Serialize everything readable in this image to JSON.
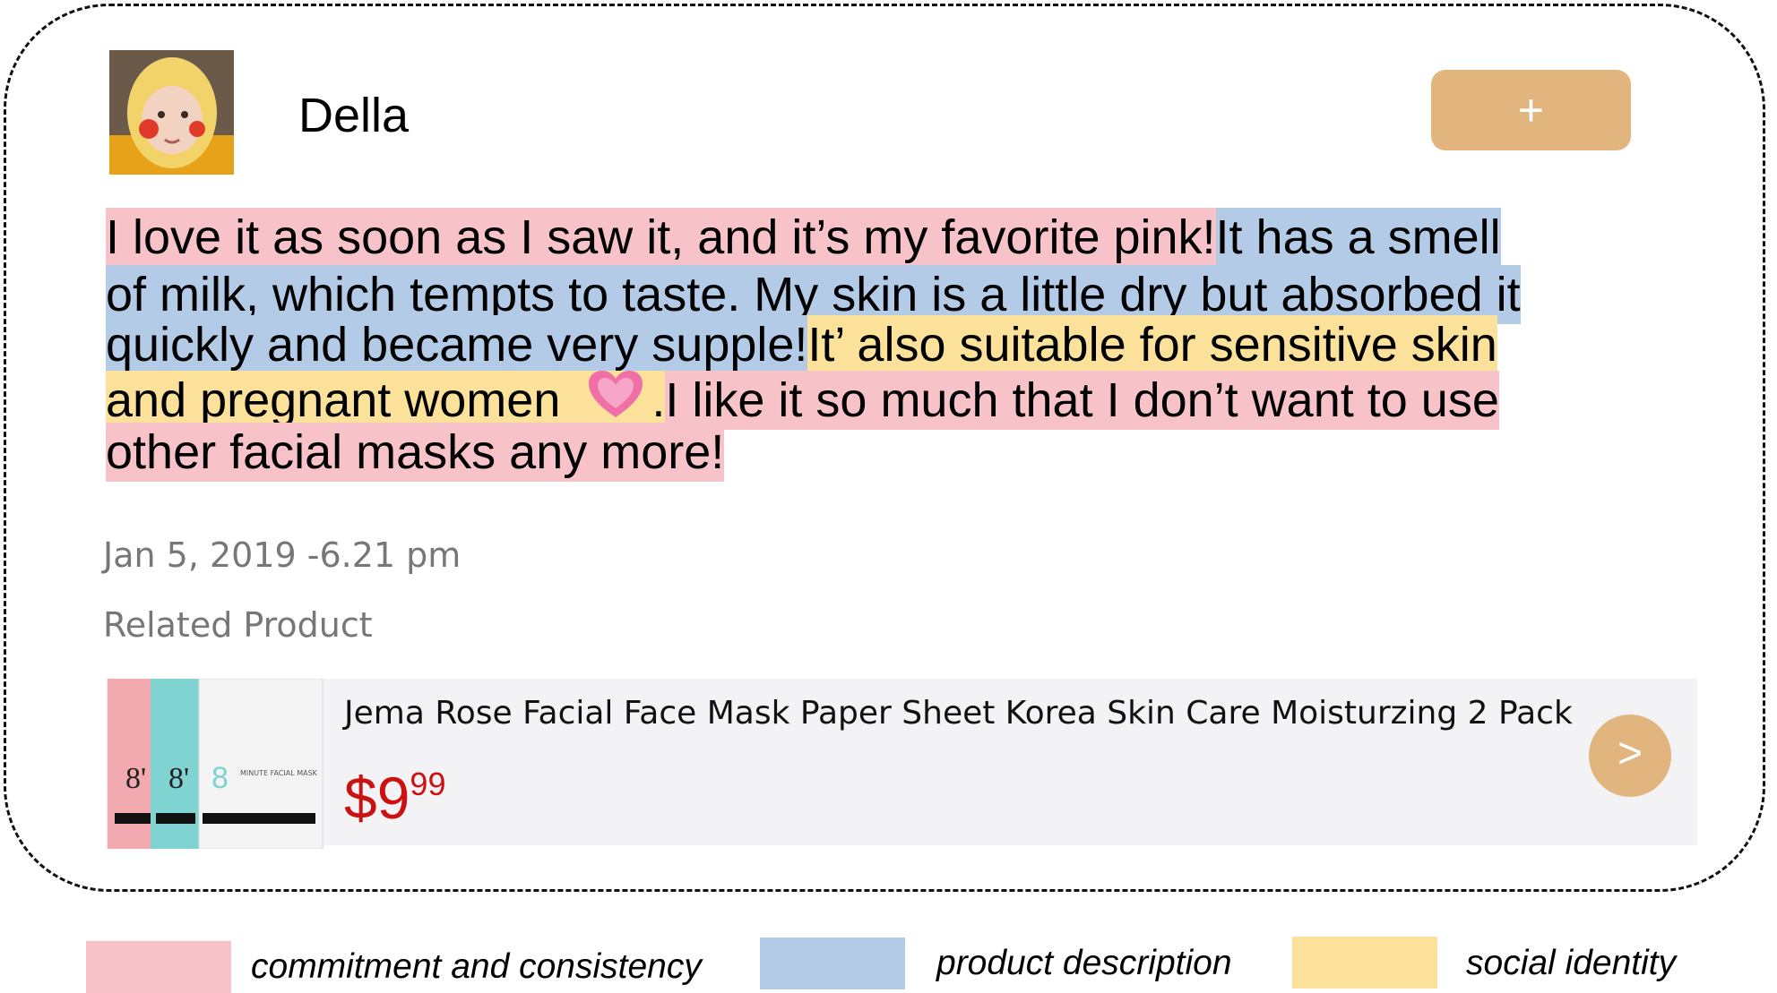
{
  "post": {
    "username": "Della",
    "follow_label": "+",
    "review_lines": [
      [
        {
          "text": "I love it as soon as I saw it, and it’s my favorite pink! ",
          "type": "commitment"
        },
        {
          "text": "It has a smell",
          "type": "product"
        }
      ],
      [
        {
          "text": "of milk, which tempts to taste. My skin is a little dry but absorbed it",
          "type": "product"
        }
      ],
      [
        {
          "text": "quickly and became very supple! ",
          "type": "product"
        },
        {
          "text": "It’ also suitable for sensitive skin",
          "type": "social"
        }
      ],
      [
        {
          "text": "and pregnant women",
          "type": "social"
        },
        {
          "text": ". ",
          "type": "social"
        },
        {
          "text": "I like it so much that I don’t want to use",
          "type": "commitment"
        }
      ],
      [
        {
          "text": "other facial masks any more!",
          "type": "commitment"
        }
      ]
    ],
    "date": "Jan 5, 2019 -6.21 pm",
    "related_label": "Related Product"
  },
  "product": {
    "title": "Jema Rose Facial Face Mask Paper Sheet Korea Skin Care Moisturzing 2 Pack",
    "price_dollars": "$9",
    "price_cents": "99",
    "go_label": ">",
    "image_text": {
      "num1": "8'",
      "num2": "8'",
      "num3": "8",
      "mask_label": "MINUTE FACIAL MASK"
    }
  },
  "legend": [
    {
      "label": "commitment and consistency",
      "color": "#f7c3c8"
    },
    {
      "label": "product description",
      "color": "#b4cbe8"
    },
    {
      "label": "social identity",
      "color": "#fce19a"
    }
  ],
  "colors": {
    "accent": "#e2b57e",
    "price": "#cc1111",
    "heart": "#ef6fa6"
  },
  "icons": {
    "heart": "heart-icon",
    "avatar": "avatar-photo"
  }
}
